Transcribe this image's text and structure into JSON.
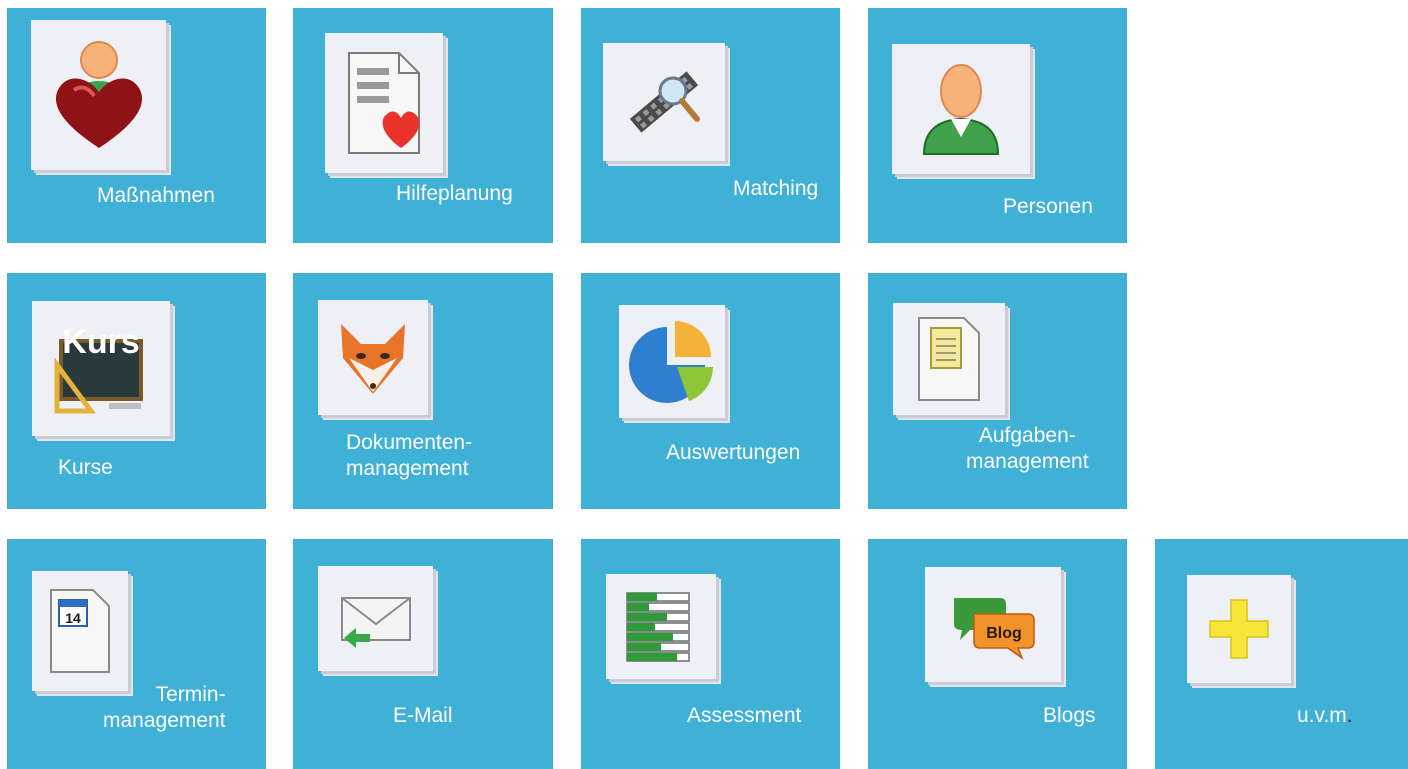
{
  "tiles": [
    {
      "id": "massnahmen",
      "label": "Maßnahmen",
      "icon": "heart-person-icon"
    },
    {
      "id": "hilfeplanung",
      "label": "Hilfeplanung",
      "icon": "document-heart-icon"
    },
    {
      "id": "matching",
      "label": "Matching",
      "icon": "magnifier-icon"
    },
    {
      "id": "personen",
      "label": "Personen",
      "icon": "person-icon"
    },
    {
      "id": "kurse",
      "label": "Kurse",
      "icon": "chalkboard-icon",
      "icon_text": "Kurs"
    },
    {
      "id": "dokumentenmanagement",
      "label_line1": "Dokumenten-",
      "label_line2": "management",
      "icon": "fox-icon"
    },
    {
      "id": "auswertungen",
      "label": "Auswertungen",
      "icon": "pie-chart-icon"
    },
    {
      "id": "aufgabenmanagement",
      "label_line1": "Aufgaben-",
      "label_line2": "management",
      "icon": "clipboard-icon"
    },
    {
      "id": "terminmanagement",
      "label_line1": "Termin-",
      "label_line2": "management",
      "icon": "calendar-icon",
      "icon_text": "14"
    },
    {
      "id": "email",
      "label": "E-Mail",
      "icon": "envelope-icon"
    },
    {
      "id": "assessment",
      "label": "Assessment",
      "icon": "list-bars-icon"
    },
    {
      "id": "blogs",
      "label": "Blogs",
      "icon": "blog-bubbles-icon",
      "icon_text": "Blog"
    },
    {
      "id": "uvm",
      "label": "u.v.m",
      "label_dot": ".",
      "icon": "plus-icon"
    }
  ],
  "colors": {
    "tile": "#3fb0d6",
    "label": "#ffffff",
    "card": "#eef0f6"
  }
}
